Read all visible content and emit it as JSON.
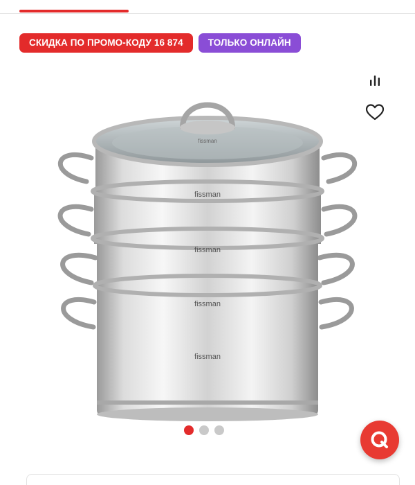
{
  "badges": {
    "promo": "СКИДКА ПО ПРОМО-КОДУ 16 874",
    "online": "ТОЛЬКО ОНЛАЙН"
  },
  "product": {
    "brand_on_image": "fissman",
    "gallery_total": 3,
    "gallery_active": 1
  },
  "actions": {
    "compare_icon": "compare-bars-icon",
    "favorite_icon": "heart-icon",
    "fab_icon": "chat-bubble-icon"
  },
  "colors": {
    "accent_red": "#e32b2b",
    "promo_purple": "#8a4dd6",
    "dot_inactive": "#c9c9c9"
  }
}
